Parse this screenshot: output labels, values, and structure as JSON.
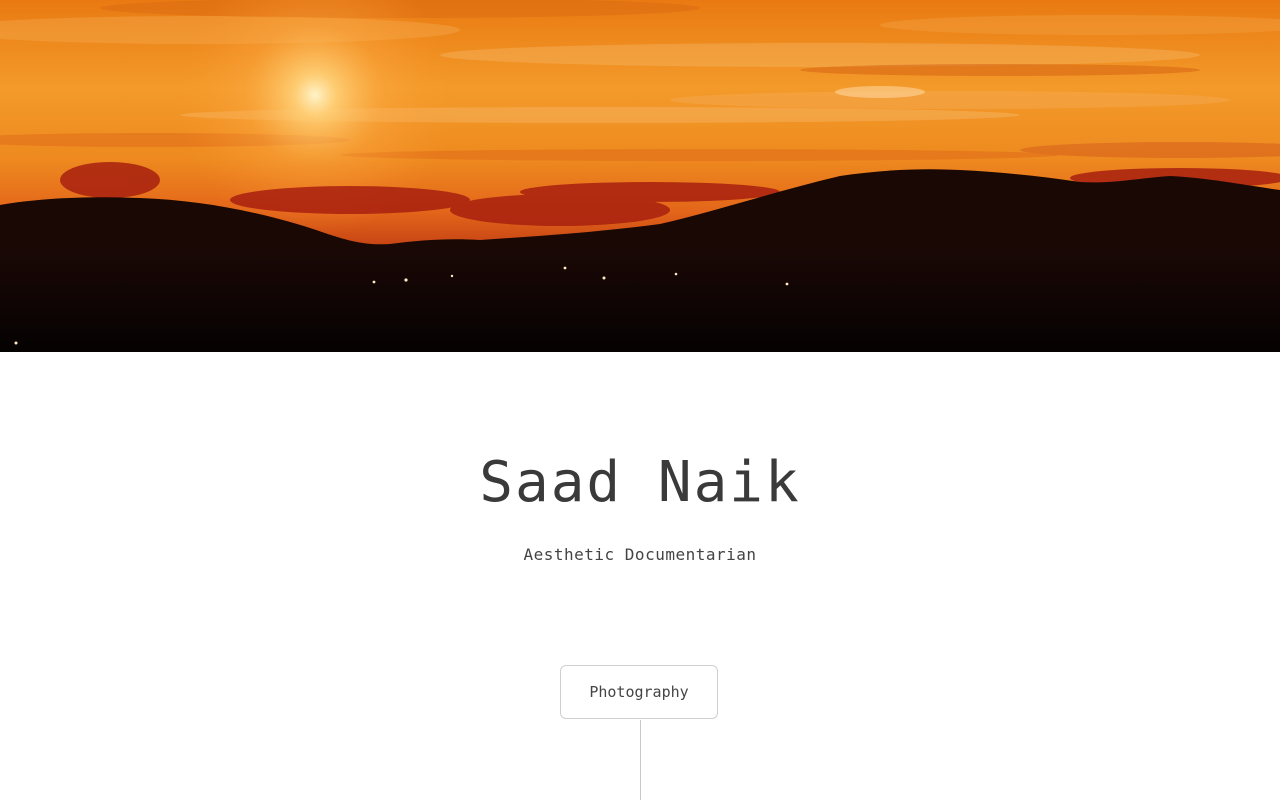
{
  "hero": {
    "image": "sunset-over-mountains-photo"
  },
  "profile": {
    "name": "Saad Naik",
    "tagline": "Aesthetic Documentarian"
  },
  "categories": {
    "items": [
      {
        "label": "Photography"
      }
    ]
  },
  "colors": {
    "text": "#3a3a3a",
    "border": "#cfcfcf",
    "sky_top": "#e0701a",
    "sky_glow": "#ffb347",
    "silhouette": "#120605"
  }
}
